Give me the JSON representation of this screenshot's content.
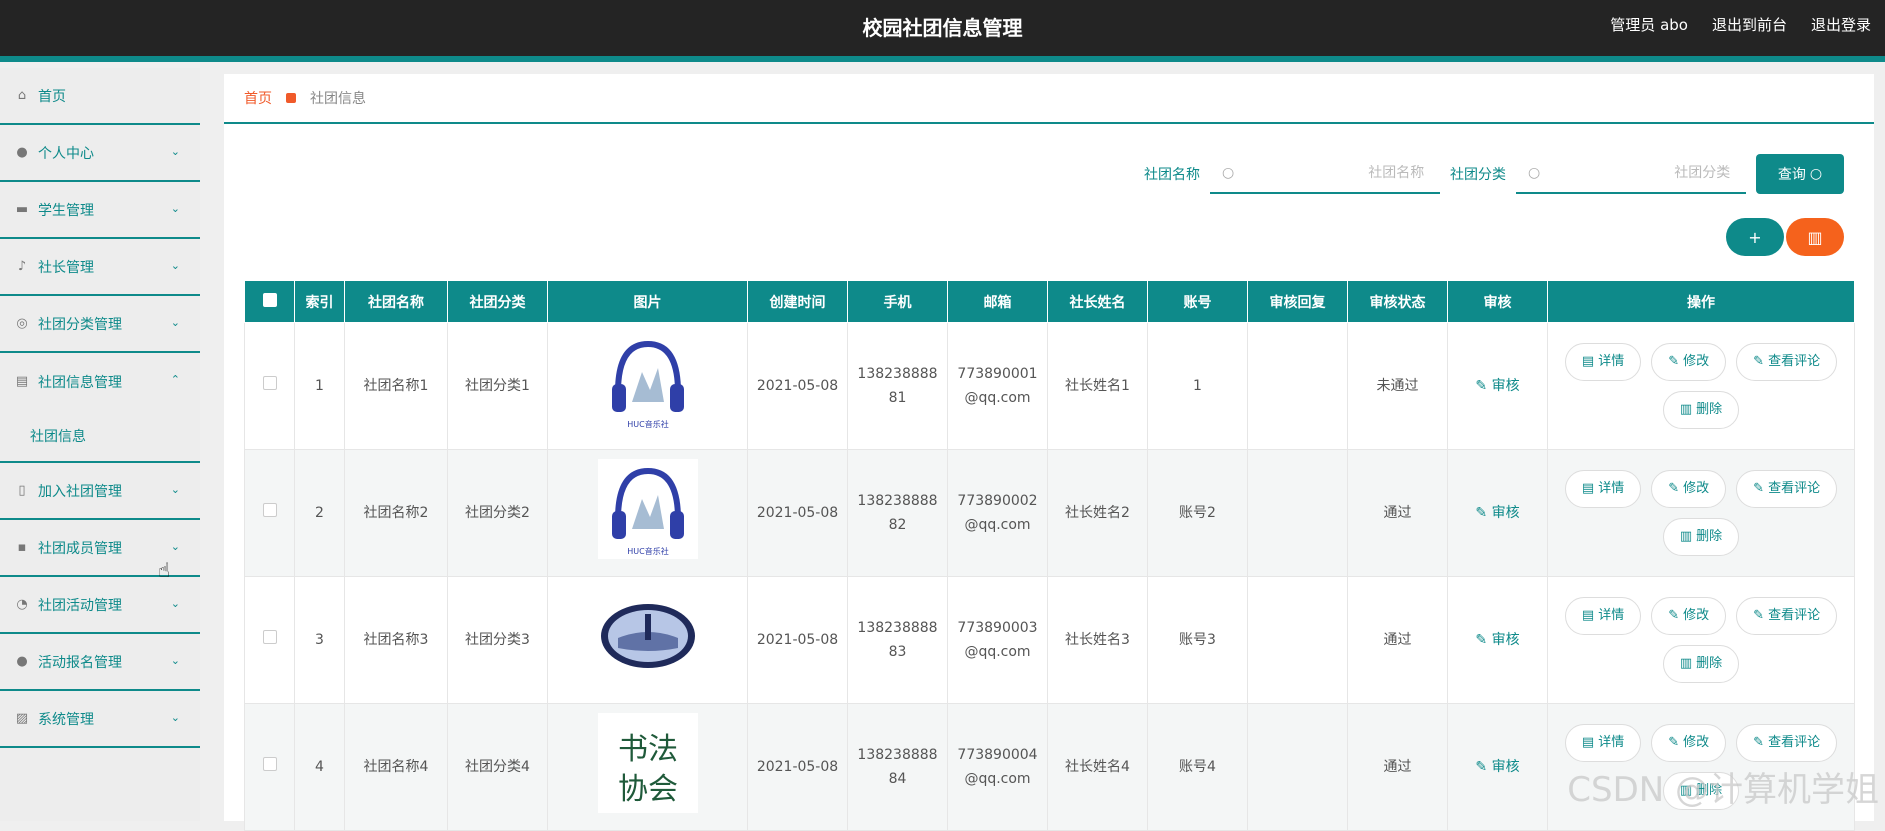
{
  "header": {
    "title": "校园社团信息管理",
    "links": [
      "管理员 abo",
      "退出到前台",
      "退出登录"
    ]
  },
  "sidebar": {
    "items": [
      {
        "label": "首页",
        "icon": "home-icon"
      },
      {
        "label": "个人中心",
        "icon": "user-icon"
      },
      {
        "label": "学生管理",
        "icon": "briefcase-icon"
      },
      {
        "label": "社长管理",
        "icon": "mic-icon"
      },
      {
        "label": "社团分类管理",
        "icon": "circle-icon"
      },
      {
        "label": "社团信息管理",
        "icon": "clipboard-icon",
        "expanded": true
      },
      {
        "label": "加入社团管理",
        "icon": "phone-icon"
      },
      {
        "label": "社团成员管理",
        "icon": "chat-icon"
      },
      {
        "label": "社团活动管理",
        "icon": "gauge-icon"
      },
      {
        "label": "活动报名管理",
        "icon": "pin-icon"
      },
      {
        "label": "系统管理",
        "icon": "chart-icon"
      }
    ],
    "sub_item": "社团信息"
  },
  "breadcrumb": {
    "home": "首页",
    "current": "社团信息"
  },
  "search": {
    "name_label": "社团名称",
    "name_placeholder": "社团名称",
    "category_label": "社团分类",
    "category_placeholder": "社团分类",
    "query_label": "查询"
  },
  "table": {
    "columns": [
      "索引",
      "社团名称",
      "社团分类",
      "图片",
      "创建时间",
      "手机",
      "邮箱",
      "社长姓名",
      "账号",
      "审核回复",
      "审核状态",
      "审核",
      "操作"
    ],
    "rows": [
      {
        "index": "1",
        "name": "社团名称1",
        "category": "社团分类1",
        "image": "headphones-logo",
        "created": "2021-05-08",
        "phone": "13823888881",
        "email": "773890001@qq.com",
        "leader": "社长姓名1",
        "account": "1",
        "reply": "",
        "status": "未通过"
      },
      {
        "index": "2",
        "name": "社团名称2",
        "category": "社团分类2",
        "image": "headphones-logo",
        "created": "2021-05-08",
        "phone": "13823888882",
        "email": "773890002@qq.com",
        "leader": "社长姓名2",
        "account": "账号2",
        "reply": "",
        "status": "通过"
      },
      {
        "index": "3",
        "name": "社团名称3",
        "category": "社团分类3",
        "image": "oval-emblem",
        "created": "2021-05-08",
        "phone": "13823888883",
        "email": "773890003@qq.com",
        "leader": "社长姓名3",
        "account": "账号3",
        "reply": "",
        "status": "通过"
      },
      {
        "index": "4",
        "name": "社团名称4",
        "category": "社团分类4",
        "image": "calligraphy-logo",
        "created": "2021-05-08",
        "phone": "13823888884",
        "email": "773890004@qq.com",
        "leader": "社长姓名4",
        "account": "账号4",
        "reply": "",
        "status": "通过"
      }
    ],
    "audit_label": "审核",
    "actions": {
      "detail": "详情",
      "edit": "修改",
      "comments": "查看评论",
      "delete": "删除"
    }
  },
  "images": {
    "headphones_caption": "HUC音乐社",
    "calligraphy_text": "书法协会"
  },
  "watermark": "CSDN @计算机学姐",
  "colors": {
    "accent": "#0e8a8a",
    "danger": "#f5621c",
    "header_bg": "#242424"
  }
}
